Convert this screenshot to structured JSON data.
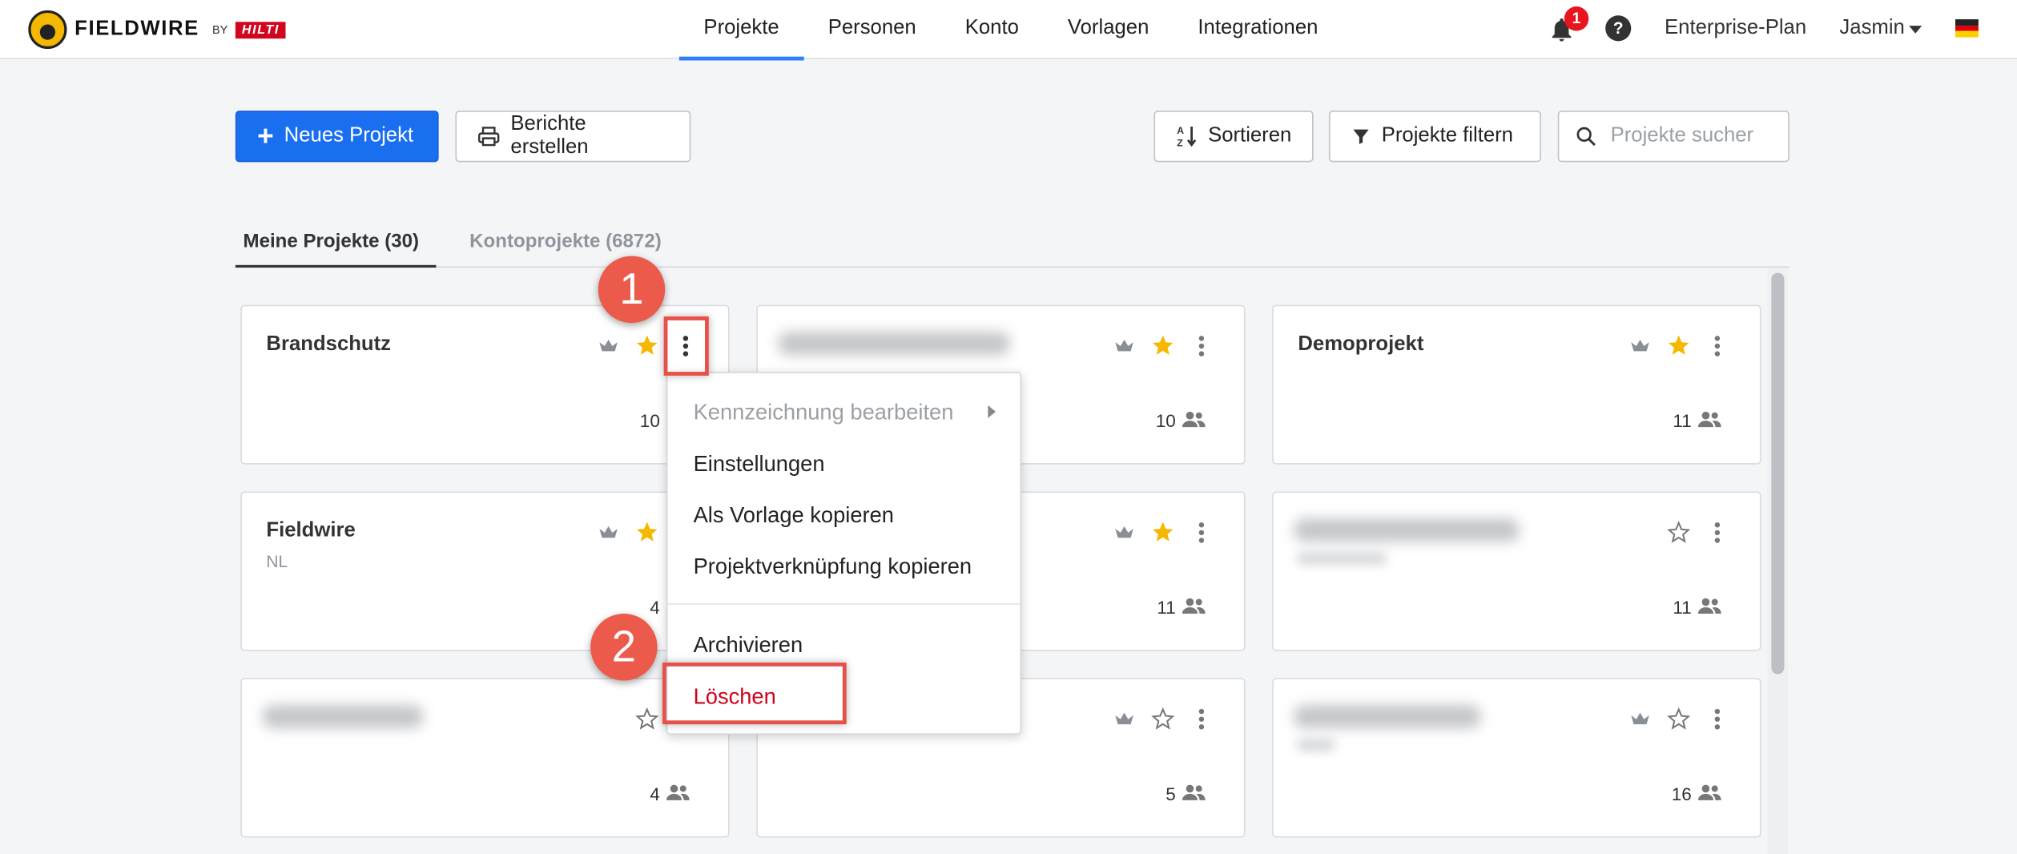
{
  "header": {
    "logo_text": "FIELDWIRE",
    "logo_by": "BY",
    "partner_logo": "HILTI",
    "nav": [
      {
        "label": "Projekte",
        "active": true
      },
      {
        "label": "Personen",
        "active": false
      },
      {
        "label": "Konto",
        "active": false
      },
      {
        "label": "Vorlagen",
        "active": false
      },
      {
        "label": "Integrationen",
        "active": false
      }
    ],
    "notification_count": "1",
    "help_icon": "?",
    "plan": "Enterprise-Plan",
    "user": "Jasmin",
    "language_flag": "german-flag-icon"
  },
  "toolbar": {
    "new_project": "Neues Projekt",
    "reports": "Berichte erstellen",
    "sort": "Sortieren",
    "filter": "Projekte filtern",
    "search_placeholder": "Projekte sucher"
  },
  "tabs": {
    "mine": "Meine Projekte (30)",
    "account": "Kontoprojekte (6872)"
  },
  "projects": [
    {
      "title": "Brandschutz",
      "subtitle": "",
      "count": "10",
      "starred": true,
      "owner": true
    },
    {
      "title": "",
      "subtitle": "",
      "count": "10",
      "starred": true,
      "owner": true,
      "blurred": true
    },
    {
      "title": "Demoprojekt",
      "subtitle": "",
      "count": "11",
      "starred": true,
      "owner": true
    },
    {
      "title": "Fieldwire",
      "subtitle": "NL",
      "count": "4",
      "starred": true,
      "owner": true
    },
    {
      "title": "",
      "subtitle": "",
      "count": "11",
      "starred": true,
      "owner": true,
      "blurred": true
    },
    {
      "title": "",
      "subtitle": "",
      "count": "11",
      "starred": false,
      "owner": false,
      "blurred": true
    },
    {
      "title": "",
      "subtitle": "",
      "count": "4",
      "starred": false,
      "owner": false,
      "blurred": true
    },
    {
      "title": "",
      "subtitle": "",
      "count": "5",
      "starred": false,
      "owner": true,
      "blurred": true
    },
    {
      "title": "",
      "subtitle": "",
      "count": "16",
      "starred": false,
      "owner": true,
      "blurred": true
    }
  ],
  "context_menu": {
    "edit_label": "Kennzeichnung bearbeiten",
    "settings": "Einstellungen",
    "copy_template": "Als Vorlage kopieren",
    "copy_link": "Projektverknüpfung kopieren",
    "archive": "Archivieren",
    "delete": "Löschen"
  },
  "annotations": {
    "step1": "1",
    "step2": "2"
  },
  "colors": {
    "primary": "#1a6ff0",
    "star": "#f5b800",
    "danger": "#d0021b",
    "annotation": "#ec5a4b"
  }
}
